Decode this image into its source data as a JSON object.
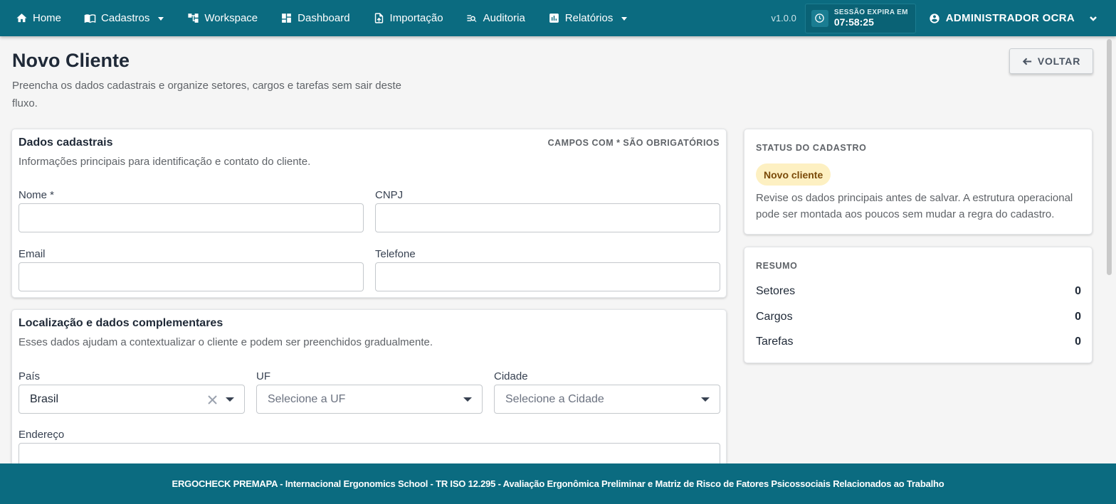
{
  "nav": {
    "items": [
      {
        "label": "Home",
        "icon": "home-icon",
        "has_menu": false
      },
      {
        "label": "Cadastros",
        "icon": "book-icon",
        "has_menu": true
      },
      {
        "label": "Workspace",
        "icon": "workspace-icon",
        "has_menu": false
      },
      {
        "label": "Dashboard",
        "icon": "dashboard-icon",
        "has_menu": false
      },
      {
        "label": "Importação",
        "icon": "import-icon",
        "has_menu": false
      },
      {
        "label": "Auditoria",
        "icon": "audit-icon",
        "has_menu": false
      },
      {
        "label": "Relatórios",
        "icon": "chart-icon",
        "has_menu": true
      }
    ],
    "version": "v1.0.0",
    "session_label": "SESSÃO EXPIRA EM",
    "session_time": "07:58:25",
    "user_name": "ADMINISTRADOR OCRA"
  },
  "page": {
    "title": "Novo Cliente",
    "subtitle": "Preencha os dados cadastrais e organize setores, cargos e tarefas sem sair deste fluxo.",
    "back_label": "VOLTAR"
  },
  "dados": {
    "title": "Dados cadastrais",
    "required_note": "CAMPOS COM * SÃO OBRIGATÓRIOS",
    "description": "Informações principais para identificação e contato do cliente.",
    "fields": {
      "nome": {
        "label": "Nome *",
        "value": ""
      },
      "cnpj": {
        "label": "CNPJ",
        "value": ""
      },
      "email": {
        "label": "Email",
        "value": ""
      },
      "telefone": {
        "label": "Telefone",
        "value": ""
      }
    }
  },
  "localizacao": {
    "title": "Localização e dados complementares",
    "description": "Esses dados ajudam a contextualizar o cliente e podem ser preenchidos gradualmente.",
    "pais": {
      "label": "País",
      "value": "Brasil"
    },
    "uf": {
      "label": "UF",
      "placeholder": "Selecione a UF"
    },
    "cidade": {
      "label": "Cidade",
      "placeholder": "Selecione a Cidade"
    },
    "endereco": {
      "label": "Endereço",
      "value": ""
    }
  },
  "status": {
    "heading": "STATUS DO CADASTRO",
    "badge": "Novo cliente",
    "badge_color": "#fdf0c2",
    "text": "Revise os dados principais antes de salvar. A estrutura operacional pode ser montada aos poucos sem mudar a regra do cadastro."
  },
  "resumo": {
    "heading": "RESUMO",
    "rows": [
      {
        "label": "Setores",
        "value": "0"
      },
      {
        "label": "Cargos",
        "value": "0"
      },
      {
        "label": "Tarefas",
        "value": "0"
      }
    ]
  },
  "footer": {
    "text": "ERGOCHECK PREMAPA - Internacional Ergonomics School - TR ISO 12.295 - Avaliação Ergonômica Preliminar e Matriz de Risco de Fatores Psicossociais Relacionados ao Trabalho"
  },
  "colors": {
    "primary": "#0b6b80",
    "background": "#f5f5f5"
  }
}
